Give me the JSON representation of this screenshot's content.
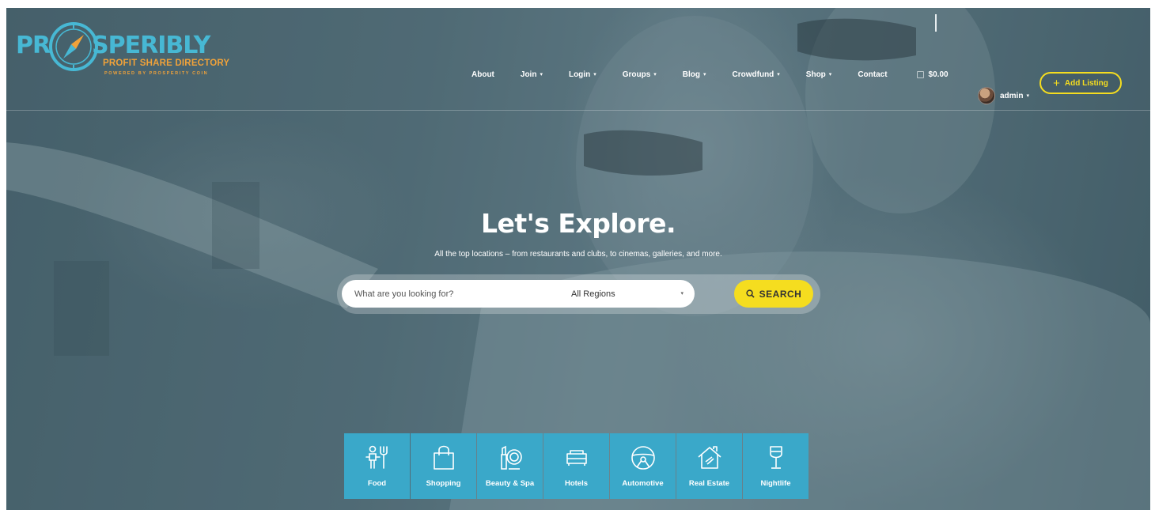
{
  "logo": {
    "word_left": "PR",
    "word_right": "SPERIBLY",
    "subtitle": "PROFIT SHARE DIRECTORY",
    "tagline": "POWERED BY PROSPERITY COIN"
  },
  "nav": {
    "items": [
      {
        "label": "About",
        "has_caret": false
      },
      {
        "label": "Join",
        "has_caret": true
      },
      {
        "label": "Login",
        "has_caret": true
      },
      {
        "label": "Groups",
        "has_caret": true
      },
      {
        "label": "Blog",
        "has_caret": true
      },
      {
        "label": "Crowdfund",
        "has_caret": true
      },
      {
        "label": "Shop",
        "has_caret": true
      },
      {
        "label": "Contact",
        "has_caret": false
      }
    ],
    "caret": "▾",
    "cart_total": "$0.00"
  },
  "user": {
    "name": "admin",
    "caret": "▾"
  },
  "add_listing": {
    "plus": "+",
    "label": "Add Listing"
  },
  "hero": {
    "title": "Let's Explore.",
    "subtitle": "All the top locations – from restaurants and clubs, to cinemas, galleries, and more."
  },
  "search": {
    "placeholder": "What are you looking for?",
    "region": "All Regions",
    "region_caret": "▾",
    "button_label": "SEARCH"
  },
  "categories": [
    {
      "label": "Food",
      "icon": "food-icon"
    },
    {
      "label": "Shopping",
      "icon": "shopping-bag-icon"
    },
    {
      "label": "Beauty & Spa",
      "icon": "beauty-spa-icon"
    },
    {
      "label": "Hotels",
      "icon": "bed-icon"
    },
    {
      "label": "Automotive",
      "icon": "steering-wheel-icon"
    },
    {
      "label": "Real Estate",
      "icon": "house-icon"
    },
    {
      "label": "Nightlife",
      "icon": "wine-glass-icon"
    }
  ],
  "colors": {
    "accent_yellow": "#f5dd1f",
    "category_blue": "#3aa8c9",
    "logo_blue": "#47b8d4",
    "logo_orange": "#f0a23a"
  }
}
